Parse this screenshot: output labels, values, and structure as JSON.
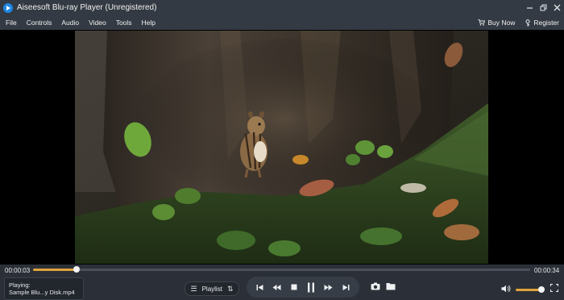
{
  "window": {
    "title": "Aiseesoft Blu-ray Player (Unregistered)"
  },
  "menu": {
    "items": [
      {
        "label": "File"
      },
      {
        "label": "Controls"
      },
      {
        "label": "Audio"
      },
      {
        "label": "Video"
      },
      {
        "label": "Tools"
      },
      {
        "label": "Help"
      }
    ],
    "buy_now": "Buy Now",
    "register": "Register"
  },
  "player": {
    "elapsed": "00:00:03",
    "duration": "00:00:34",
    "progress_fraction": 0.088,
    "volume_fraction": 0.9,
    "now_playing_label": "Playing:",
    "now_playing_file": "Sample Blu...y Disk.mp4",
    "playlist_label": "Playlist"
  },
  "colors": {
    "accent": "#e0a33a",
    "titlebar": "#343a43",
    "controls_bg": "#2b3038"
  }
}
